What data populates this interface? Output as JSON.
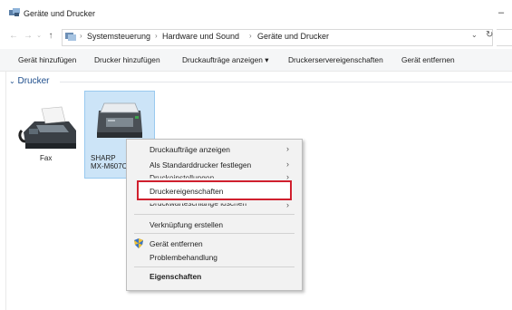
{
  "window": {
    "title": "Geräte und Drucker"
  },
  "address": {
    "crumbs": [
      "Systemsteuerung",
      "Hardware und Sound",
      "Geräte und Drucker"
    ]
  },
  "toolbar": {
    "commands": [
      "Gerät hinzufügen",
      "Drucker hinzufügen",
      "Druckaufträge anzeigen ▾",
      "Druckerservereigenschaften",
      "Gerät entfernen"
    ]
  },
  "group": {
    "label": "Drucker"
  },
  "devices": {
    "fax": "Fax",
    "sharp_line1": "SHARP",
    "sharp_line2": "MX-M607C"
  },
  "context_menu": {
    "items": [
      "Druckaufträge anzeigen",
      "Als Standarddrucker festlegen",
      "Druckeinstellungen",
      "Druckereigenschaften",
      "Druckwarteschlange löschen",
      "Verknüpfung erstellen",
      "Gerät entfernen",
      "Problembehandlung",
      "Eigenschaften"
    ]
  },
  "colors": {
    "selection_fill": "#cce4f7",
    "highlight_border": "#d0202e",
    "group_header": "#1e4e8c"
  },
  "icons": [
    "folder-printer-icon",
    "fax-icon",
    "printer-icon",
    "shield-icon",
    "chevron-right-icon",
    "back-arrow-icon",
    "forward-arrow-icon",
    "up-arrow-icon",
    "refresh-icon"
  ]
}
